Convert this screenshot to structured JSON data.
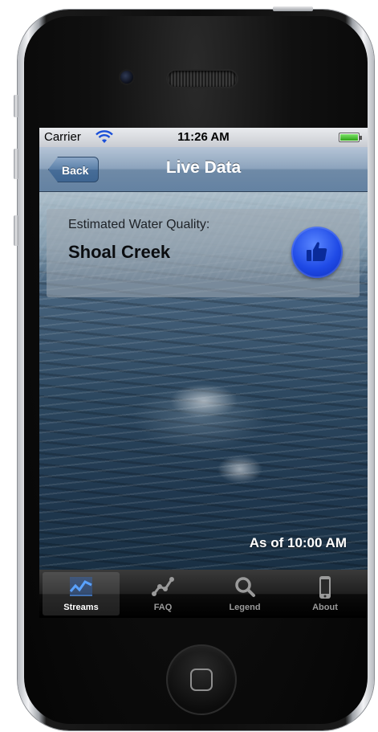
{
  "status_bar": {
    "carrier": "Carrier",
    "time": "11:26 AM"
  },
  "nav_bar": {
    "back_label": "Back",
    "title": "Live Data"
  },
  "card": {
    "label": "Estimated Water Quality:",
    "stream_name": "Shoal Creek",
    "status_icon": "thumbs-up-icon",
    "status_color": "#1f4ae6"
  },
  "timestamp": "As of  10:00 AM",
  "tab_bar": {
    "selected": "Streams",
    "tabs": [
      {
        "label": "Streams",
        "icon": "chart-icon"
      },
      {
        "label": "FAQ",
        "icon": "graph-icon"
      },
      {
        "label": "Legend",
        "icon": "search-icon"
      },
      {
        "label": "About",
        "icon": "phone-icon"
      }
    ]
  }
}
